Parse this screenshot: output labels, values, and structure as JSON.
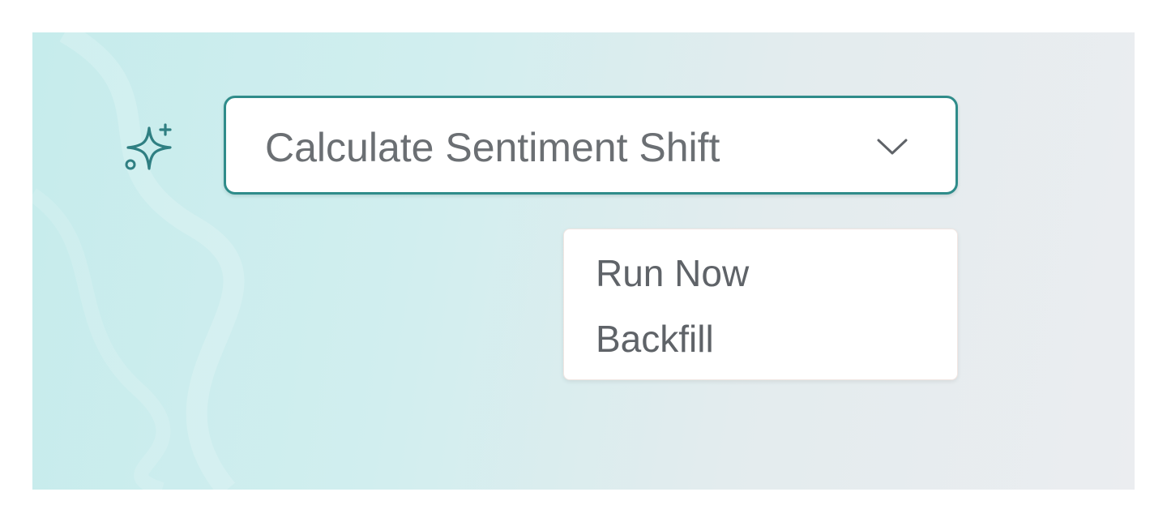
{
  "colors": {
    "accent": "#2f8c8a",
    "text": "#6b6f73",
    "menu_text": "#5f6368",
    "panel_start": "#c6ecec",
    "panel_end": "#ebedf0"
  },
  "icons": {
    "leading": "sparkle-icon",
    "dropdown": "chevron-down-icon"
  },
  "action_select": {
    "value": "Calculate Sentiment Shift"
  },
  "menu": {
    "items": [
      {
        "label": "Run Now"
      },
      {
        "label": "Backfill"
      }
    ]
  }
}
